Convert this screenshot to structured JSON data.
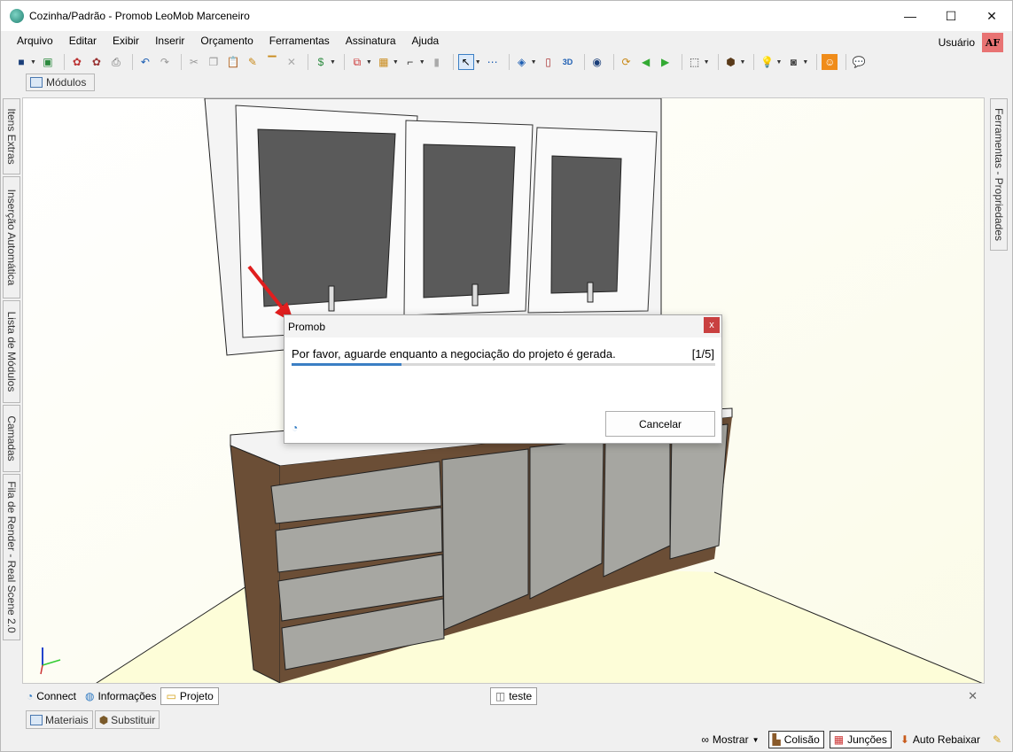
{
  "window": {
    "title": "Cozinha/Padrão - Promob LeoMob Marceneiro",
    "controls": {
      "minimize": "—",
      "maximize": "☐",
      "close": "✕"
    }
  },
  "menu": [
    "Arquivo",
    "Editar",
    "Exibir",
    "Inserir",
    "Orçamento",
    "Ferramentas",
    "Assinatura",
    "Ajuda"
  ],
  "user": {
    "label": "Usuário",
    "avatar": "AF",
    "avatar_color": "#e87373"
  },
  "toolbar_icons": [
    "save-icon",
    "export-icon",
    "render-icon",
    "render2-icon",
    "print-icon",
    "undo-icon",
    "redo-icon",
    "cut-icon",
    "copy-icon",
    "paste-icon",
    "paint-icon",
    "paint-roller-icon",
    "delete-icon",
    "money-icon",
    "module-icon",
    "grid-icon",
    "connector-icon",
    "select-icon",
    "measure-icon",
    "layers-icon",
    "door-icon",
    "3d-icon",
    "eye-icon",
    "sync-icon",
    "arrow-left-icon",
    "arrow-right-icon",
    "view-icon",
    "box-icon",
    "light-icon",
    "camera-icon",
    "user-icon",
    "chat-icon"
  ],
  "top_tab": {
    "label": "Módulos"
  },
  "left_tabs": [
    "Itens Extras",
    "Inserção Automática",
    "Lista de Módulos",
    "Camadas",
    "Fila de Render - Real Scene 2.0"
  ],
  "right_tab": "Ferramentas - Propriedades",
  "dialog": {
    "title": "Promob",
    "close": "x",
    "message": "Por favor, aguarde enquanto a negociação do projeto é gerada.",
    "step": "[1/5]",
    "progress": 0.26,
    "cancel_label": "Cancelar"
  },
  "bottom_tabs": [
    {
      "label": "Connect",
      "icon": "connect-icon"
    },
    {
      "label": "Informações",
      "icon": "globe-icon"
    },
    {
      "label": "Projeto",
      "icon": "folder-icon"
    }
  ],
  "doc_tab": {
    "label": "teste"
  },
  "lower_tabs": [
    "Materiais",
    "Substituir"
  ],
  "status": {
    "show": "Mostrar",
    "collision": "Colisão",
    "junctions": "Junções",
    "auto_lower": "Auto Rebaixar"
  },
  "colors": {
    "accent": "#3b7fc4",
    "dialog_close": "#c94040",
    "viewport_bg": "#fffff6"
  }
}
